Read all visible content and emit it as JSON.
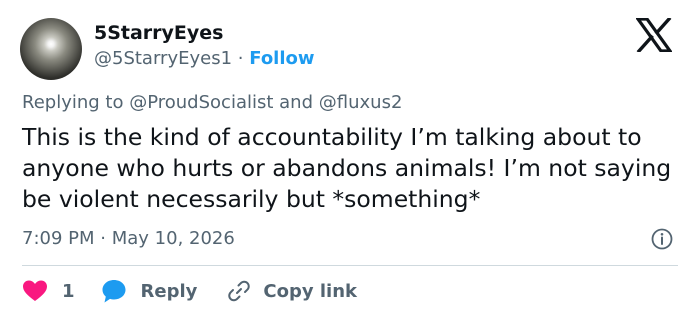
{
  "author": {
    "display_name": "5StarryEyes",
    "handle": "@5StarryEyes1",
    "separator": "·",
    "follow_label": "Follow"
  },
  "reply_context": {
    "prefix": "Replying to",
    "mention1": "@ProudSocialist",
    "conjunction": "and",
    "mention2": "@fluxus2"
  },
  "tweet": {
    "text": "This is the kind of accountability I’m talking about to anyone who hurts or abandons animals! I’m not saying be violent necessarily but *something*",
    "time": "7:09 PM",
    "separator": "·",
    "date": "May 10, 2026"
  },
  "actions": {
    "like_count": "1",
    "reply_label": "Reply",
    "copy_label": "Copy link"
  },
  "colors": {
    "text": "#0f1419",
    "secondary": "#536471",
    "link": "#1d9bf0",
    "like": "#f91880",
    "divider": "#cfd9de"
  },
  "icons": [
    "x-logo-icon",
    "info-icon",
    "heart-icon",
    "reply-bubble-icon",
    "link-icon"
  ]
}
